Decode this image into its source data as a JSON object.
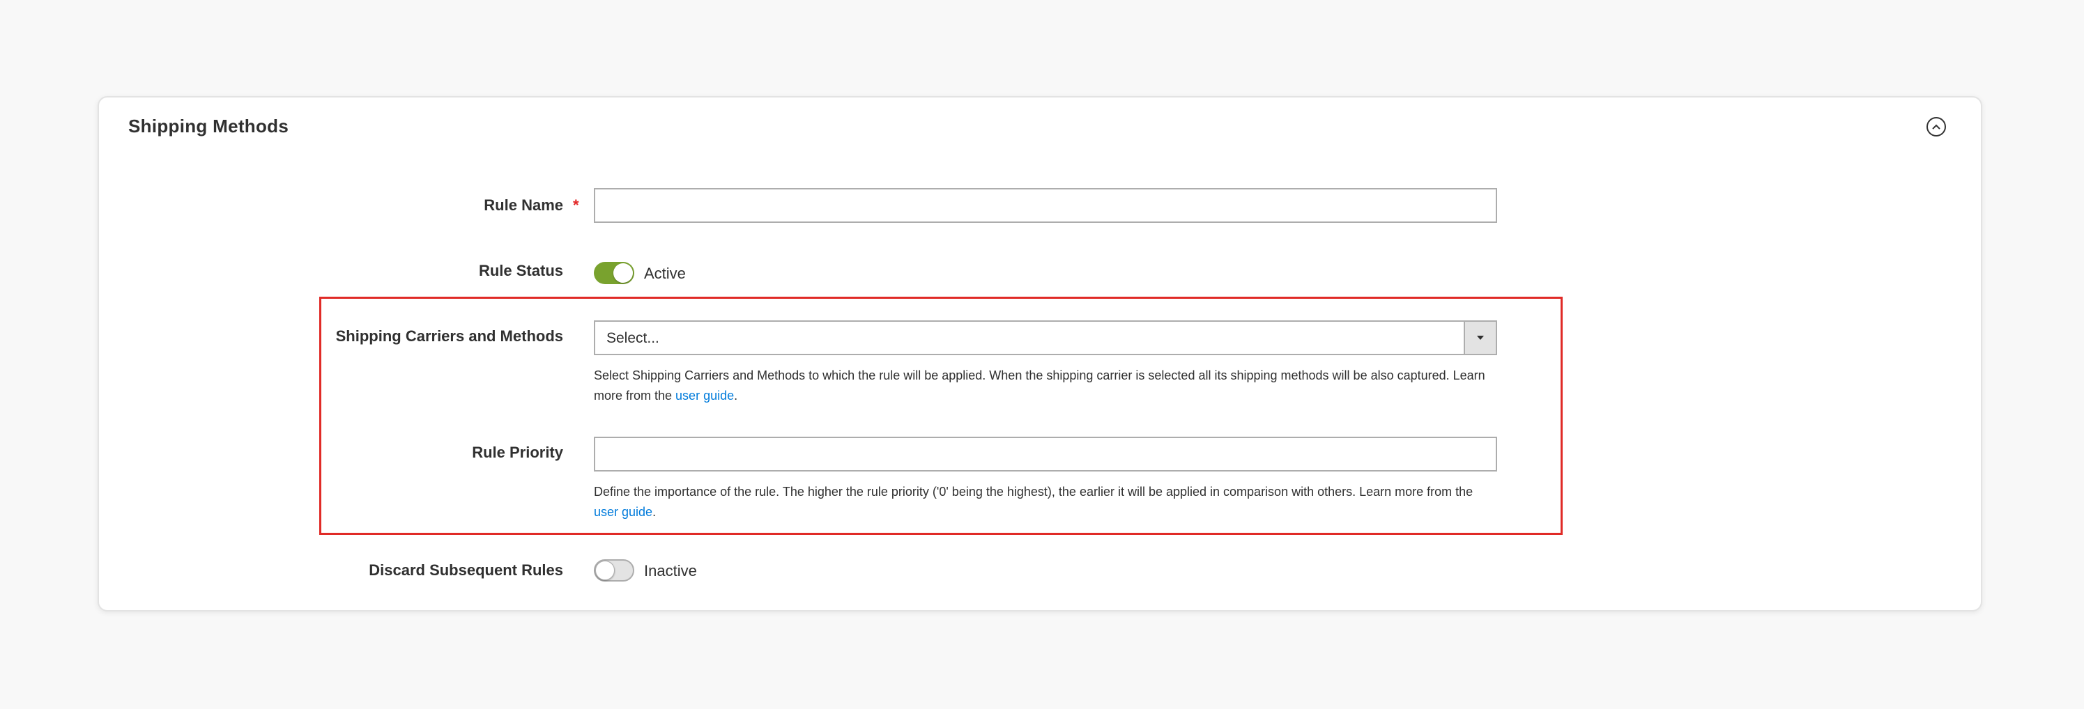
{
  "section": {
    "title": "Shipping Methods"
  },
  "fields": {
    "rule_name": {
      "label": "Rule Name",
      "required_mark": "*",
      "value": ""
    },
    "rule_status": {
      "label": "Rule Status",
      "state_text": "Active",
      "enabled": true
    },
    "carriers": {
      "label": "Shipping Carriers and Methods",
      "placeholder": "Select...",
      "note_text": "Select Shipping Carriers and Methods to which the rule will be applied. When the shipping carrier is selected all its shipping methods will be also captured. Learn more from the ",
      "note_link": "user guide",
      "note_end": "."
    },
    "rule_priority": {
      "label": "Rule Priority",
      "value": "",
      "note_text": "Define the importance of the rule. The higher the rule priority ('0' being the highest), the earlier it will be applied in comparison with others. Learn more from the ",
      "note_link": "user guide",
      "note_end": "."
    },
    "discard_rules": {
      "label": "Discard Subsequent Rules",
      "state_text": "Inactive",
      "enabled": false
    }
  },
  "colors": {
    "accent_toggle_on": "#79a22e",
    "highlight_border": "#e02b27",
    "link": "#007bdb",
    "required": "#e22626"
  },
  "icons": {
    "collapse": "chevron-up-circle-icon",
    "select_arrow": "caret-down-icon"
  }
}
